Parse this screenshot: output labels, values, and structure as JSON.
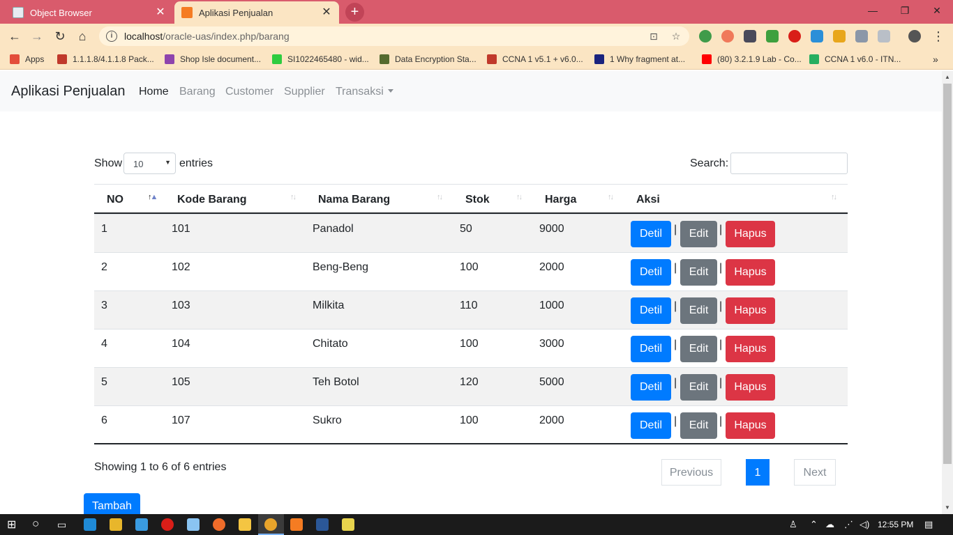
{
  "browser": {
    "tabs": [
      {
        "title": "Object Browser",
        "active": false
      },
      {
        "title": "Aplikasi Penjualan",
        "active": true
      }
    ],
    "new_tab_icon": "+",
    "window_controls": {
      "minimize": "—",
      "maximize": "❐",
      "close": "✕"
    },
    "url": {
      "host": "localhost",
      "path": "/oracle-uas/index.php/barang"
    },
    "bookmarks": [
      {
        "label": "Apps"
      },
      {
        "label": "1.1.1.8/4.1.1.8 Pack..."
      },
      {
        "label": "Shop Isle document..."
      },
      {
        "label": "SI1022465480 - wid..."
      },
      {
        "label": "Data Encryption Sta..."
      },
      {
        "label": "CCNA 1 v5.1 + v6.0..."
      },
      {
        "label": "1 Why fragment at..."
      },
      {
        "label": "(80) 3.2.1.9 Lab - Co..."
      },
      {
        "label": "CCNA 1 v6.0 - ITN..."
      }
    ],
    "more_bookmarks": "»"
  },
  "navbar": {
    "brand": "Aplikasi Penjualan",
    "links": [
      {
        "label": "Home",
        "active": true
      },
      {
        "label": "Barang"
      },
      {
        "label": "Customer"
      },
      {
        "label": "Supplier"
      },
      {
        "label": "Transaksi",
        "dropdown": true
      }
    ]
  },
  "table": {
    "show_label": "Show",
    "entries_value": "10",
    "entries_label": "entries",
    "search_label": "Search:",
    "search_value": "",
    "columns": [
      "NO",
      "Kode Barang",
      "Nama Barang",
      "Stok",
      "Harga",
      "Aksi"
    ],
    "sorted_column": "NO",
    "rows": [
      {
        "no": "1",
        "kode": "101",
        "nama": "Panadol",
        "stok": "50",
        "harga": "9000"
      },
      {
        "no": "2",
        "kode": "102",
        "nama": "Beng-Beng",
        "stok": "100",
        "harga": "2000"
      },
      {
        "no": "3",
        "kode": "103",
        "nama": "Milkita",
        "stok": "110",
        "harga": "1000"
      },
      {
        "no": "4",
        "kode": "104",
        "nama": "Chitato",
        "stok": "100",
        "harga": "3000"
      },
      {
        "no": "5",
        "kode": "105",
        "nama": "Teh Botol",
        "stok": "120",
        "harga": "5000"
      },
      {
        "no": "6",
        "kode": "107",
        "nama": "Sukro",
        "stok": "100",
        "harga": "2000"
      }
    ],
    "actions": {
      "detil": "Detil",
      "edit": "Edit",
      "hapus": "Hapus",
      "separator": "|"
    },
    "info": "Showing 1 to 6 of 6 entries",
    "pagination": {
      "previous": "Previous",
      "current": "1",
      "next": "Next"
    }
  },
  "add_button": "Tambah",
  "taskbar": {
    "clock": "12:55 PM"
  },
  "colors": {
    "primary": "#007bff",
    "secondary": "#6c757d",
    "danger": "#dc3545",
    "tab_strip": "#d95b6c",
    "toolbar": "#fbe5c3"
  }
}
